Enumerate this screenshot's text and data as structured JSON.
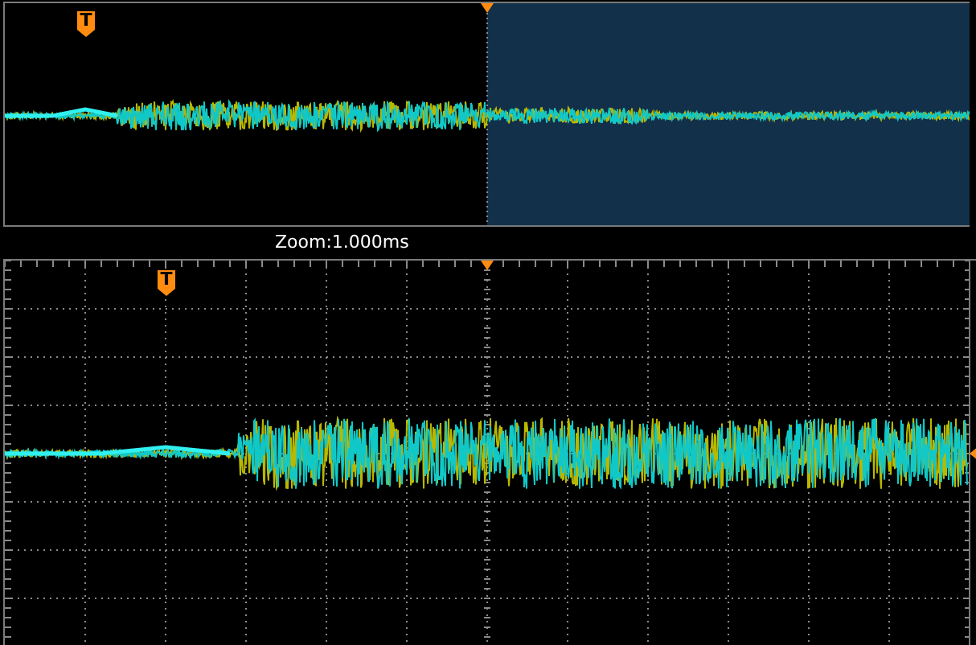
{
  "overview": {
    "trigger_marker": "T"
  },
  "zoom_label": "Zoom:1.000ms",
  "main": {
    "trigger_marker": "T"
  }
}
